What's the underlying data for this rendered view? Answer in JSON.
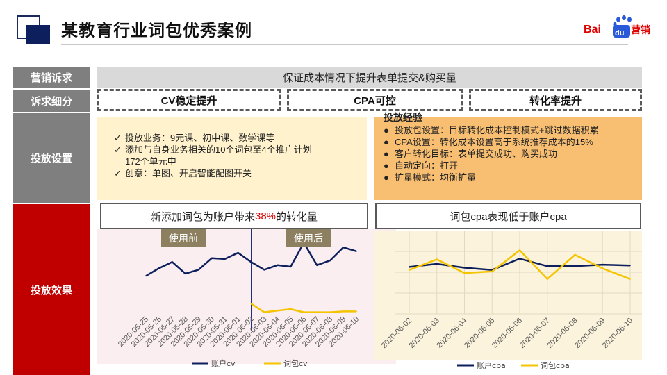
{
  "header": {
    "title": "某教育行业词包优秀案例",
    "brand_bai": "Bai",
    "brand_du": "du",
    "brand_marketing": "营销"
  },
  "rows": {
    "marketing_appeal": {
      "label": "营销诉求",
      "text": "保证成本情况下提升表单提交&购买量"
    },
    "appeal_detail": {
      "label": "诉求细分",
      "items": [
        "CV稳定提升",
        "CPA可控",
        "转化率提升"
      ]
    },
    "delivery_setup": {
      "label": "投放设置",
      "left_items": [
        "投放业务：9元课、初中课、数学课等",
        "添加与自身业务相关的10个词包至4个推广计划",
        "172个单元中",
        "创意：单图、开启智能配图开关"
      ],
      "exp_title": "投放经验",
      "exp_items": [
        "投放包设置：目标转化成本控制模式+跳过数据积累",
        "CPA设置：转化成本设置高于系统推荐成本的15%",
        "客户转化目标：表单提交成功、购买成功",
        "自动定向：打开",
        "扩量模式：均衡扩量"
      ]
    },
    "delivery_effect": {
      "label": "投放效果",
      "caption1_pre": "新添加词包为账户带来",
      "caption1_pct": "38%",
      "caption1_post": "的转化量",
      "caption2": "词包cpa表现低于账户cpa",
      "tag_before": "使用前",
      "tag_after": "使用后"
    }
  },
  "colors": {
    "navy": "#0d1f5c",
    "red": "#c00000",
    "gold": "#f5c400",
    "gray": "#7f7f7f"
  },
  "chart_data": [
    {
      "type": "line",
      "x": [
        "2020-05-25",
        "2020-05-26",
        "2020-05-27",
        "2020-05-28",
        "2020-05-29",
        "2020-05-30",
        "2020-05-31",
        "2020-06-01",
        "2020-06-02",
        "2020-06-03",
        "2020-06-04",
        "2020-06-05",
        "2020-06-06",
        "2020-06-07",
        "2020-06-08",
        "2020-06-09",
        "2020-06-10"
      ],
      "series": [
        {
          "name": "账户cv",
          "color": "#0d1f5c",
          "values": [
            25,
            35,
            43,
            28,
            33,
            48,
            47,
            55,
            43,
            33,
            39,
            37,
            68,
            39,
            45,
            62,
            57
          ]
        },
        {
          "name": "词包cv",
          "color": "#f5c400",
          "values": [
            null,
            null,
            null,
            null,
            null,
            null,
            null,
            null,
            -11,
            -22,
            -20,
            -18,
            -22,
            -22,
            -22,
            -21,
            -21
          ]
        }
      ],
      "ylim": [
        -35,
        82
      ],
      "grid": false,
      "legend": "bottom",
      "divider_after": "2020-06-02"
    },
    {
      "type": "line",
      "x": [
        "2020-06-02",
        "2020-06-03",
        "2020-06-04",
        "2020-06-05",
        "2020-06-06",
        "2020-06-07",
        "2020-06-08",
        "2020-06-09",
        "2020-06-10"
      ],
      "series": [
        {
          "name": "账户cpa",
          "color": "#0d1f5c",
          "values": [
            42,
            46,
            41,
            38,
            53,
            43,
            43,
            45,
            44
          ]
        },
        {
          "name": "词包cpa",
          "color": "#f5c400",
          "values": [
            38,
            52,
            34,
            36,
            64,
            26,
            58,
            40,
            26
          ]
        }
      ],
      "ylim": [
        -20,
        90
      ],
      "grid": true,
      "legend": "bottom"
    }
  ]
}
